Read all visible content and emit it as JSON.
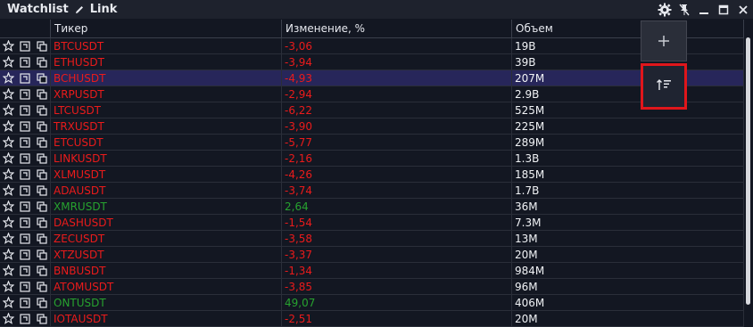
{
  "titlebar": {
    "title": "Watchlist",
    "list_name": "Link"
  },
  "headers": {
    "ticker": "Тикер",
    "change": "Изменение, %",
    "volume": "Объем"
  },
  "colors": {
    "negative": "#ea1b1b",
    "positive": "#27a22f",
    "selected_row": "#27265a",
    "highlight_border": "#e0161b"
  },
  "rows": [
    {
      "ticker": "BTCUSDT",
      "change": "-3,06",
      "volume": "19B",
      "dir": "neg"
    },
    {
      "ticker": "ETHUSDT",
      "change": "-3,94",
      "volume": "39B",
      "dir": "neg"
    },
    {
      "ticker": "BCHUSDT",
      "change": "-4,93",
      "volume": "207M",
      "dir": "neg",
      "selected": true
    },
    {
      "ticker": "XRPUSDT",
      "change": "-2,94",
      "volume": "2.9B",
      "dir": "neg"
    },
    {
      "ticker": "LTCUSDT",
      "change": "-6,22",
      "volume": "525M",
      "dir": "neg"
    },
    {
      "ticker": "TRXUSDT",
      "change": "-3,90",
      "volume": "225M",
      "dir": "neg"
    },
    {
      "ticker": "ETCUSDT",
      "change": "-5,77",
      "volume": "289M",
      "dir": "neg"
    },
    {
      "ticker": "LINKUSDT",
      "change": "-2,16",
      "volume": "1.3B",
      "dir": "neg"
    },
    {
      "ticker": "XLMUSDT",
      "change": "-4,26",
      "volume": "185M",
      "dir": "neg"
    },
    {
      "ticker": "ADAUSDT",
      "change": "-3,74",
      "volume": "1.7B",
      "dir": "neg"
    },
    {
      "ticker": "XMRUSDT",
      "change": "2,64",
      "volume": "36M",
      "dir": "pos"
    },
    {
      "ticker": "DASHUSDT",
      "change": "-1,54",
      "volume": "7.3M",
      "dir": "neg"
    },
    {
      "ticker": "ZECUSDT",
      "change": "-3,58",
      "volume": "13M",
      "dir": "neg"
    },
    {
      "ticker": "XTZUSDT",
      "change": "-3,37",
      "volume": "20M",
      "dir": "neg"
    },
    {
      "ticker": "BNBUSDT",
      "change": "-1,34",
      "volume": "984M",
      "dir": "neg"
    },
    {
      "ticker": "ATOMUSDT",
      "change": "-3,85",
      "volume": "96M",
      "dir": "neg"
    },
    {
      "ticker": "ONTUSDT",
      "change": "49,07",
      "volume": "406M",
      "dir": "pos"
    },
    {
      "ticker": "IOTAUSDT",
      "change": "-2,51",
      "volume": "20M",
      "dir": "neg"
    }
  ],
  "icons": {
    "edit": "pencil-icon",
    "settings": "gear-icon",
    "unpin": "unpin-icon",
    "minimize": "minimize-icon",
    "maximize": "maximize-icon",
    "close": "close-icon",
    "add": "plus-icon",
    "sort": "sort-icon",
    "favorite": "star-icon",
    "open_chart": "open-chart-icon",
    "copy": "copy-icon"
  }
}
